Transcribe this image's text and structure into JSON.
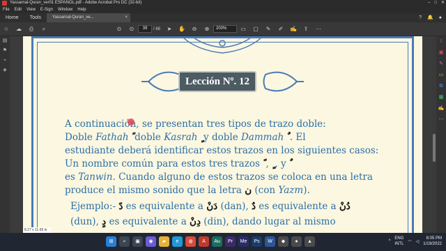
{
  "window": {
    "title": "Yassarnal-Quran_ver01 ESPAÑOL.pdf - Adobe Acrobat Pro DC (32-bit)",
    "controls": [
      "–",
      "□",
      "✕"
    ]
  },
  "menu": [
    "File",
    "Edit",
    "View",
    "E-Sign",
    "Window",
    "Help"
  ],
  "tabs": {
    "home": "Home",
    "tools": "Tools",
    "doc": "Yassarnal-Quran_ve...",
    "close": "×"
  },
  "toolbar": {
    "page_current": "39",
    "page_total": "/ 68",
    "zoom": "200%"
  },
  "document": {
    "lesson": "Lección Nº. 12",
    "lines": {
      "l1": "A continuación, se presentan tres tipos de trazo doble:",
      "l2a": "Doble ",
      "l2b": "Fathah",
      "l2c": " doble ",
      "l2d": "Kasrah",
      "l2e": " y doble ",
      "l2f": "Dammah",
      "l2g": ". El",
      "l3": "estudiante deberá identificar estos trazos en los siguientes casos:",
      "l4a": "Un nombre común para estos tres trazos",
      "l4b": ",",
      "l4c": ", y",
      "l5a": "es ",
      "l5b": "Tanwin",
      "l5c": ". Cuando alguno de estos trazos se coloca en una letra",
      "l6a": "produce el mismo sonido que la letra ",
      "l6b": " (con ",
      "l6c": "Yazm",
      "l6d": ").",
      "l7a": "Ejemplo:- ",
      "l7b": " es equivalente a ",
      "l7c": " (dan), ",
      "l7d": " es equivalente a ",
      "l8a": "(dun), ",
      "l8b": " es equivalente a ",
      "l8c": " (din), dando lugar al mismo"
    },
    "arabic": {
      "fathah": "ً",
      "kasrah": "ٍ",
      "dammah": "ٌ",
      "noon": "ن",
      "dan": "دً",
      "dan_full": "دَنْ",
      "dun": "دٌ",
      "dun_full": "دُنْ",
      "din": "دٍ",
      "din_full": "دِنْ"
    }
  },
  "status": {
    "page_size": "8.27 x 11.69 in"
  },
  "taskbar": {
    "lang1": "ENG",
    "lang2": "INTL",
    "time": "8:05 PM",
    "date": "1/19/2022"
  },
  "colors": {
    "text_blue": "#2d6fa6",
    "border_blue": "#4a7ab8",
    "page_bg": "#fbf7e0",
    "badge_bg": "#4d5b62"
  }
}
